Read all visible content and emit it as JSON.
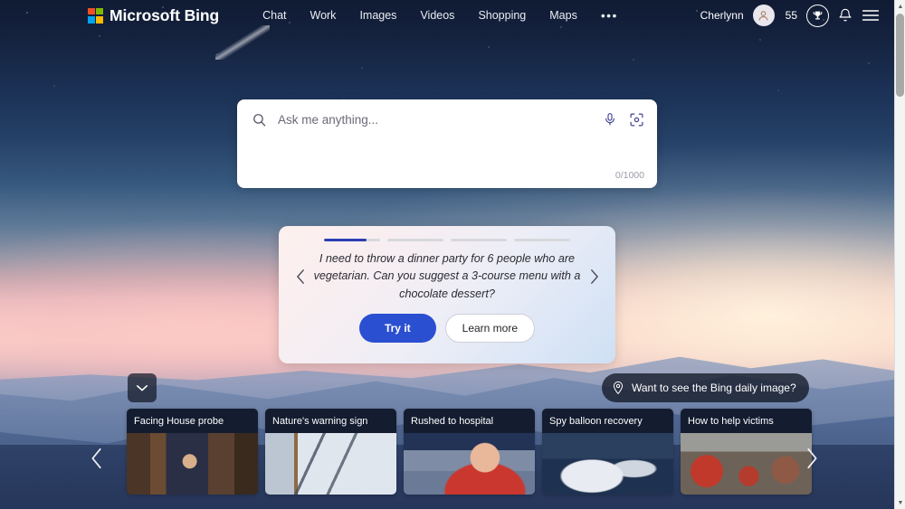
{
  "header": {
    "brand": "Microsoft Bing",
    "logo_icon": "microsoft-logo-icon",
    "nav": [
      {
        "label": "Chat"
      },
      {
        "label": "Work"
      },
      {
        "label": "Images"
      },
      {
        "label": "Videos"
      },
      {
        "label": "Shopping"
      },
      {
        "label": "Maps"
      }
    ],
    "more_label": "•••",
    "user_name": "Cherlynn",
    "avatar_icon": "person-avatar-icon",
    "rewards_count": "55",
    "rewards_icon": "trophy-icon",
    "notifications_icon": "bell-icon",
    "menu_icon": "hamburger-menu-icon"
  },
  "search": {
    "icon": "search-icon",
    "placeholder": "Ask me anything...",
    "value": "",
    "mic_icon": "microphone-icon",
    "lens_icon": "visual-search-camera-icon",
    "char_count": "0/1000"
  },
  "suggestion": {
    "progress": [
      75,
      0,
      0,
      0
    ],
    "prev_icon": "chevron-left-icon",
    "next_icon": "chevron-right-icon",
    "text": "I need to throw a dinner party for 6 people who are vegetarian. Can you suggest a 3-course menu with a chocolate dessert?",
    "try_label": "Try it",
    "learn_label": "Learn more",
    "accent_color": "#2b4fd1"
  },
  "daily_image": {
    "icon": "location-pin-icon",
    "label": "Want to see the Bing daily image?"
  },
  "collapse": {
    "icon": "chevron-down-icon"
  },
  "news": {
    "prev_icon": "chevron-left-icon",
    "next_icon": "chevron-right-icon",
    "cards": [
      {
        "title": "Facing House probe",
        "image": "img-congress"
      },
      {
        "title": "Nature's warning sign",
        "image": "img-powerline"
      },
      {
        "title": "Rushed to hospital",
        "image": "img-stadium"
      },
      {
        "title": "Spy balloon recovery",
        "image": "img-balloon"
      },
      {
        "title": "How to help victims",
        "image": "img-crowd"
      }
    ]
  },
  "scrollbar": {
    "up_icon": "scroll-up-arrow-icon",
    "down_icon": "scroll-down-arrow-icon",
    "up_glyph": "▲",
    "down_glyph": "▼"
  }
}
